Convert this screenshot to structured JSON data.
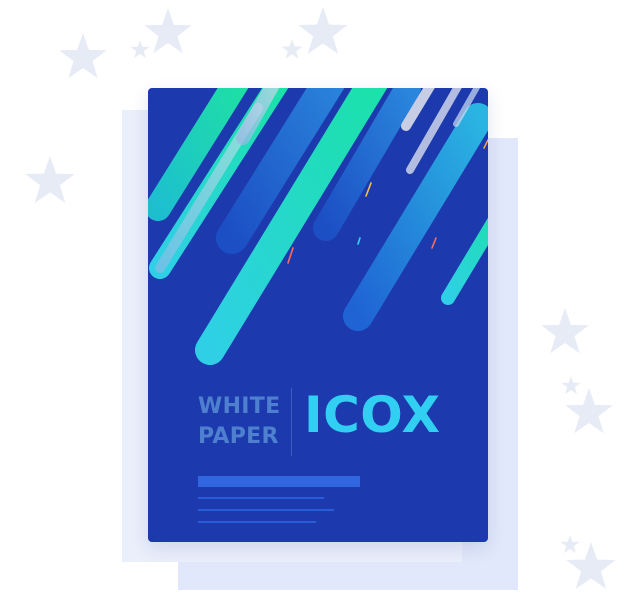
{
  "cover": {
    "label_line1": "WHITE",
    "label_line2": "PAPER",
    "brand": "ICOX"
  },
  "colors": {
    "cover_background": "#1c3aae",
    "brand_text": "#31d0f2",
    "label_text": "#4f7fcf",
    "stars": "#e7ebf6",
    "backing_sheets": "#e5ebfb"
  },
  "decorations": {
    "background_icons": [
      "star-icon"
    ]
  }
}
